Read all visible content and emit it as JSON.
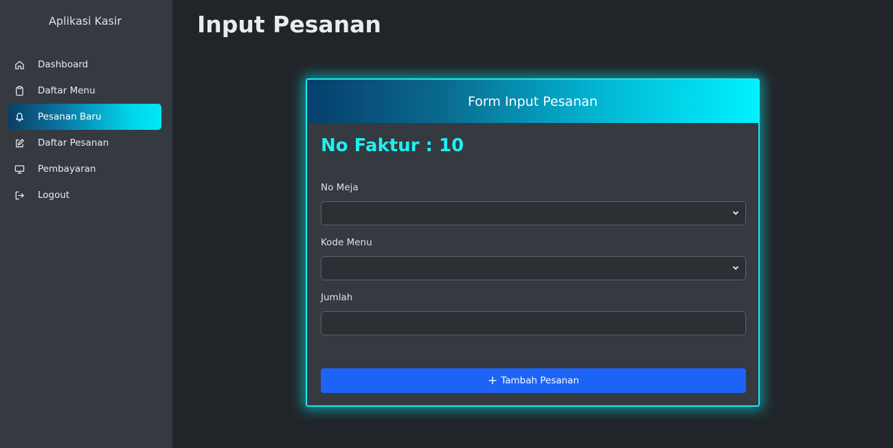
{
  "sidebar": {
    "app_title": "Aplikasi Kasir",
    "items": [
      {
        "label": "Dashboard",
        "icon": "house-icon",
        "active": false
      },
      {
        "label": "Daftar Menu",
        "icon": "clipboard-icon",
        "active": false
      },
      {
        "label": "Pesanan Baru",
        "icon": "bell-icon",
        "active": true
      },
      {
        "label": "Daftar Pesanan",
        "icon": "pencil-square-icon",
        "active": false
      },
      {
        "label": "Pembayaran",
        "icon": "display-icon",
        "active": false
      },
      {
        "label": "Logout",
        "icon": "logout-icon",
        "active": false
      }
    ]
  },
  "main": {
    "page_title": "Input Pesanan",
    "form": {
      "header": "Form Input Pesanan",
      "faktur_label": "No Faktur : 10",
      "fields": {
        "no_meja": {
          "label": "No Meja",
          "value": ""
        },
        "kode_menu": {
          "label": "Kode Menu",
          "value": ""
        },
        "jumlah": {
          "label": "Jumlah",
          "value": ""
        }
      },
      "submit_label": "Tambah Pesanan",
      "submit_icon": "plus-icon"
    }
  },
  "colors": {
    "accent_cyan": "#1ee8f2",
    "primary_button": "#1d63f6",
    "sidebar_bg": "#343a40",
    "page_bg": "#212529"
  }
}
